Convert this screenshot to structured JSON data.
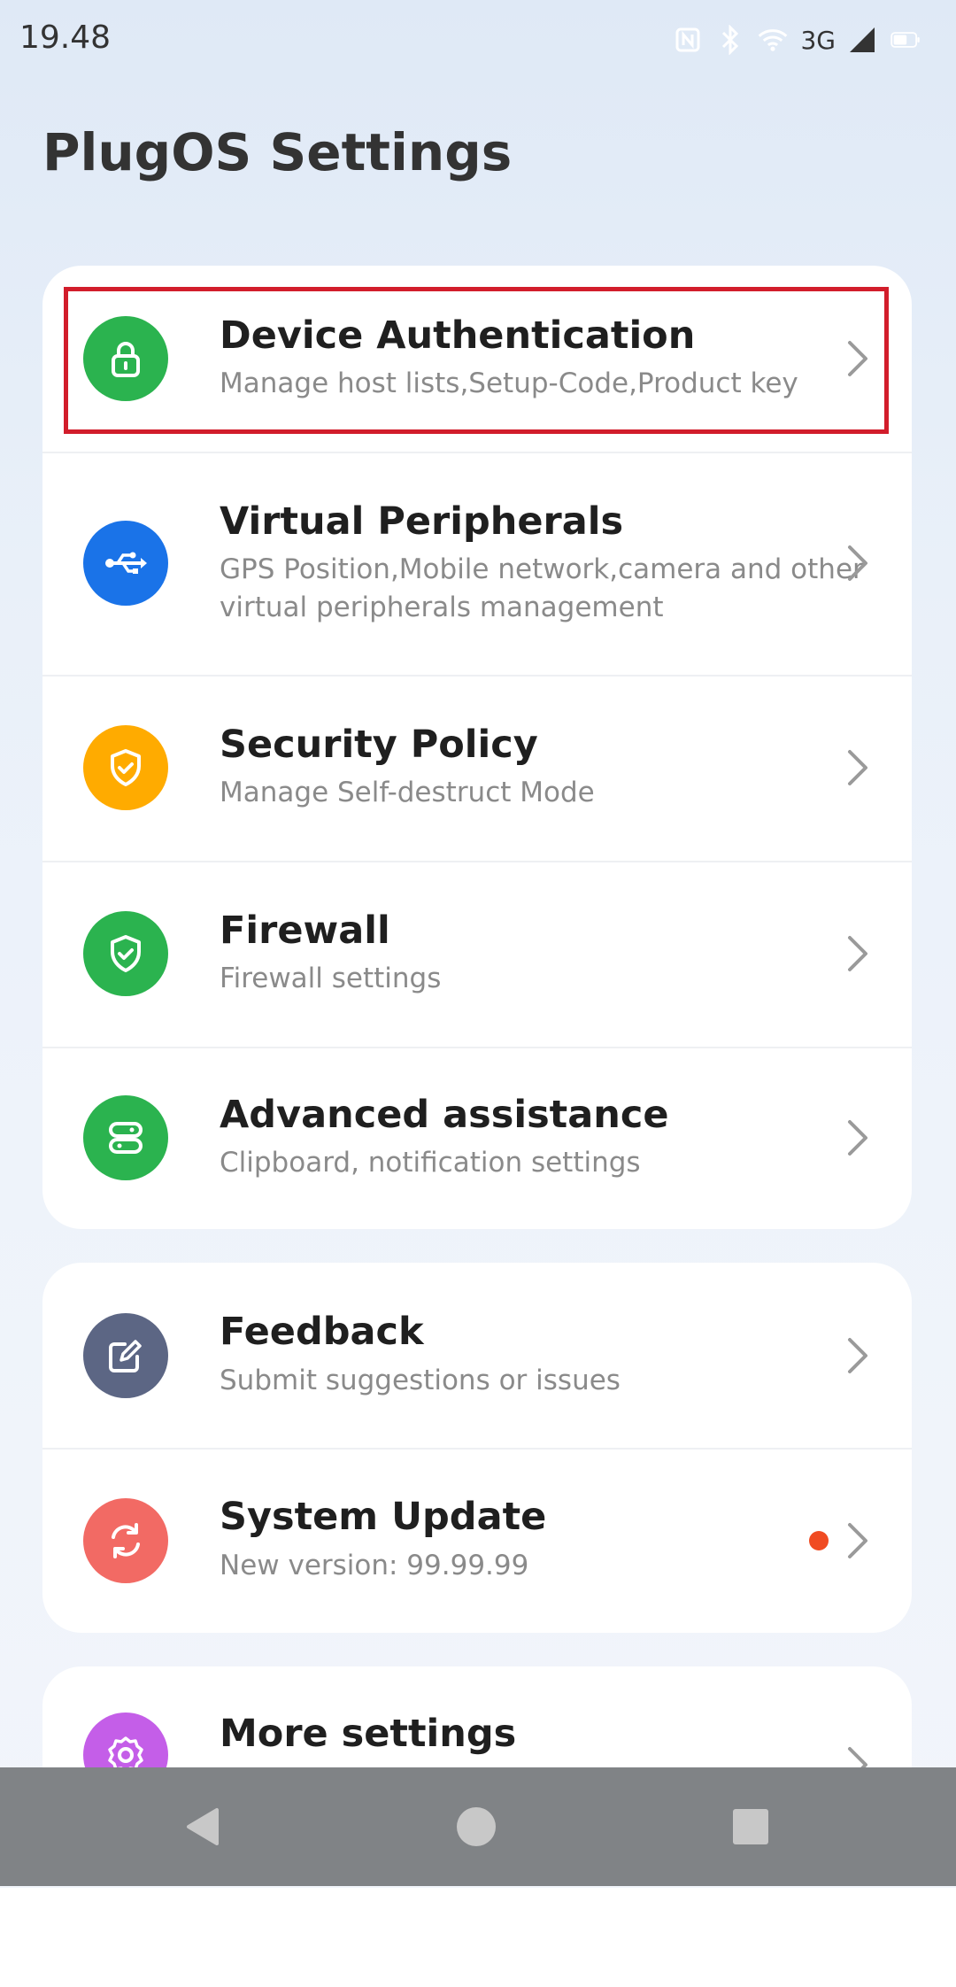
{
  "status_bar": {
    "time": "19.48",
    "network": "3G",
    "icons": [
      "nfc-icon",
      "bluetooth-icon",
      "wifi-icon",
      "signal-icon",
      "battery-icon"
    ]
  },
  "page": {
    "title": "PlugOS Settings"
  },
  "groups": [
    {
      "items": [
        {
          "title": "Device Authentication",
          "subtitle": "Manage host lists,Setup-Code,Product key",
          "icon": "lock-icon",
          "color": "#2bb34f"
        },
        {
          "title": "Virtual Peripherals",
          "subtitle": "GPS Position,Mobile network,camera and other virtual peripherals management",
          "icon": "usb-icon",
          "color": "#1a73e8"
        },
        {
          "title": "Security Policy",
          "subtitle": "Manage Self-destruct Mode",
          "icon": "shield-icon",
          "color": "#ffab00"
        },
        {
          "title": "Firewall",
          "subtitle": "Firewall settings",
          "icon": "shield-check-icon",
          "color": "#2bb34f"
        },
        {
          "title": "Advanced assistance",
          "subtitle": "Clipboard, notification settings",
          "icon": "toggle-icon",
          "color": "#2bb34f"
        }
      ]
    },
    {
      "items": [
        {
          "title": "Feedback",
          "subtitle": "Submit suggestions or issues",
          "icon": "edit-icon",
          "color": "#5c6684"
        },
        {
          "title": "System Update",
          "subtitle": "New version: 99.99.99",
          "icon": "refresh-icon",
          "color": "#f26a64",
          "badge": "update-dot"
        }
      ]
    },
    {
      "items": [
        {
          "title": "More settings",
          "subtitle": "",
          "icon": "gear-icon",
          "color": "#c45ee8"
        }
      ]
    }
  ],
  "navigation": {
    "buttons": [
      "back-icon",
      "home-icon",
      "recents-icon"
    ]
  }
}
